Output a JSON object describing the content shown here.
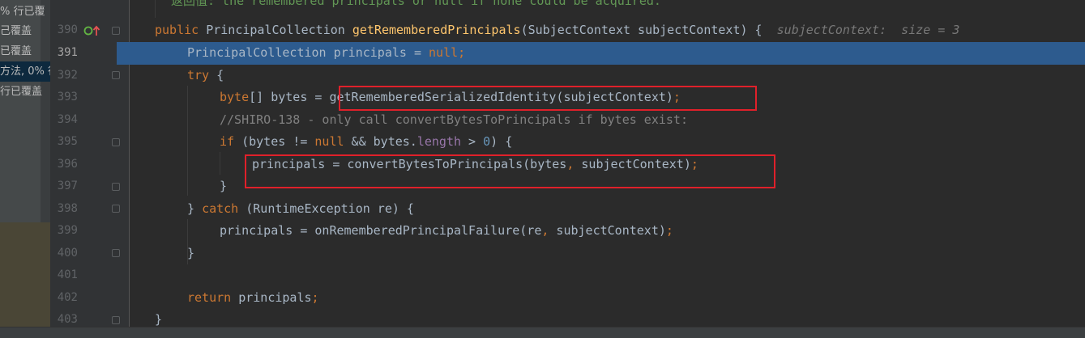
{
  "coverage_panel": {
    "rows": [
      "% 行已覆",
      "己覆盖",
      "已覆盖",
      "方法, 0% 行",
      "行已覆盖"
    ]
  },
  "doc_comment": "返回值: the remembered principals or null if none could be acquired.",
  "lines": [
    {
      "no": "390",
      "current": false
    },
    {
      "no": "391",
      "current": true
    },
    {
      "no": "392",
      "current": false
    },
    {
      "no": "393",
      "current": false
    },
    {
      "no": "394",
      "current": false
    },
    {
      "no": "395",
      "current": false
    },
    {
      "no": "396",
      "current": false
    },
    {
      "no": "397",
      "current": false
    },
    {
      "no": "398",
      "current": false
    },
    {
      "no": "399",
      "current": false
    },
    {
      "no": "400",
      "current": false
    },
    {
      "no": "401",
      "current": false
    },
    {
      "no": "402",
      "current": false
    },
    {
      "no": "403",
      "current": false
    }
  ],
  "code": {
    "l390": {
      "kw": "public",
      "type": "PrincipalCollection",
      "method": "getRememberedPrincipals",
      "params": "(SubjectContext subjectContext) {",
      "hint": "subjectContext:  size = 3"
    },
    "l391": {
      "type": "PrincipalCollection",
      "rest": "principals = ",
      "kw": "null",
      "semi": ";"
    },
    "l392": {
      "kw": "try",
      "rest": " {"
    },
    "l393": {
      "kw": "byte",
      "rest": "[] bytes = ",
      "call": "getRememberedSerializedIdentity(subjectContext)",
      "semi": ";"
    },
    "l394": {
      "comment": "//SHIRO-138 - only call convertBytesToPrincipals if bytes exist:"
    },
    "l395": {
      "kw": "if",
      "a": " (bytes != ",
      "kw2": "null",
      "b": " && bytes.",
      "field": "length",
      "c": " > ",
      "num": "0",
      "d": ") {"
    },
    "l396": {
      "a": "principals = convertBytesToPrincipals(bytes",
      "comma": ",",
      "b": " subjectContext)",
      "semi": ";"
    },
    "l397": {
      "text": "}"
    },
    "l398": {
      "a": "} ",
      "kw": "catch",
      "b": " (RuntimeException re) {"
    },
    "l399": {
      "a": "principals = onRememberedPrincipalFailure(re",
      "comma": ",",
      "b": " subjectContext)",
      "semi": ";"
    },
    "l400": {
      "text": "}"
    },
    "l402": {
      "kw": "return",
      "rest": " principals",
      "semi": ";"
    },
    "l403": {
      "text": "}"
    }
  },
  "colors": {
    "background": "#2b2b2b",
    "keyword": "#cc7832",
    "method_decl": "#ffc66d",
    "field": "#9876aa",
    "number": "#6897bb",
    "comment": "#808080",
    "selection": "#2d5b8e",
    "annotation_box": "#e0202a"
  },
  "icons": [
    "implemented-method-icon",
    "override-up-arrow-icon"
  ]
}
